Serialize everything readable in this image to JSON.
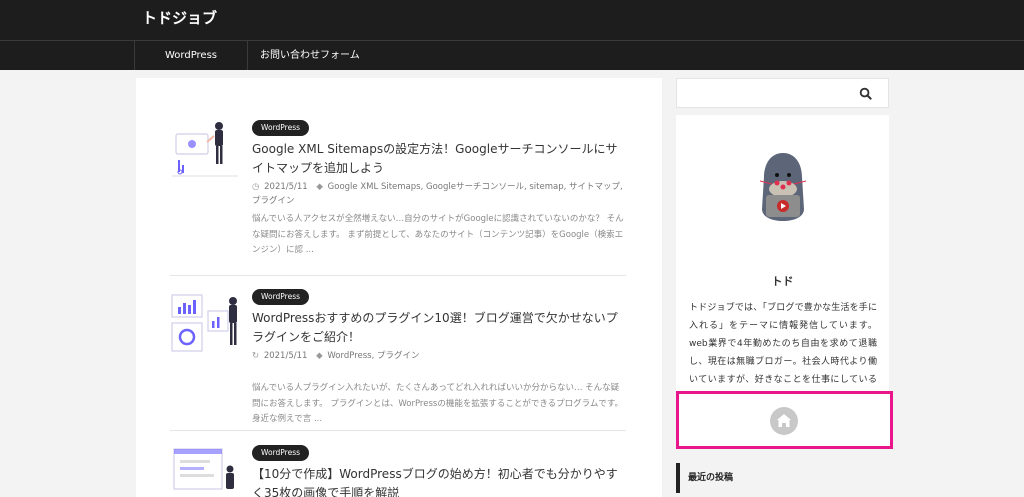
{
  "header": {
    "site_title": "トドジョブ"
  },
  "nav": {
    "items": [
      {
        "label": "WordPress"
      },
      {
        "label": "お問い合わせフォーム"
      }
    ]
  },
  "posts": [
    {
      "category": "WordPress",
      "title": "Google XML Sitemapsの設定方法！Googleサーチコンソールにサイトマップを追加しよう",
      "date_icon": "clock-icon",
      "date": "2021/5/11",
      "tags": "Google XML Sitemaps, Googleサーチコンソール, sitemap, サイトマップ, プラグイン",
      "excerpt": "悩んでいる人アクセスが全然増えない…自分のサイトがGoogleに認識されていないのかな？ そんな疑問にお答えします。 まず前提として、あなたのサイト（コンテンツ記事）をGoogle（検索エンジン）に認 ..."
    },
    {
      "category": "WordPress",
      "title": "WordPressおすすめのプラグイン10選！ブログ運営で欠かせないプラグインをご紹介！",
      "date_icon": "refresh-icon",
      "date": "2021/5/11",
      "tags": "WordPress, プラグイン",
      "excerpt": "悩んでいる人プラグイン入れたいが、たくさんあってどれ入れればいいか分からない… そんな疑問にお答えします。 プラグインとは、WorPressの機能を拡張することができるプログラムです。 身近な例えで言 ..."
    },
    {
      "category": "WordPress",
      "title": "【10分で作成】WordPressブログの始め方！初心者でも分かりやすく35枚の画像で手順を解説"
    }
  ],
  "sidebar": {
    "profile": {
      "name": "トド",
      "description": "トドジョブでは、「ブログで豊かな生活を手に入れる」をテーマに情報発信しています。 web業界で4年勤めたのち自由を求めて退職し、現在は無職ブロガー。社会人時代より働いていますが、好きなことを仕事にしているので、全く苦ではありません。趣味であるランニングしながら、人生を謳歌しています。"
    },
    "recent_title": "最近の投稿"
  }
}
